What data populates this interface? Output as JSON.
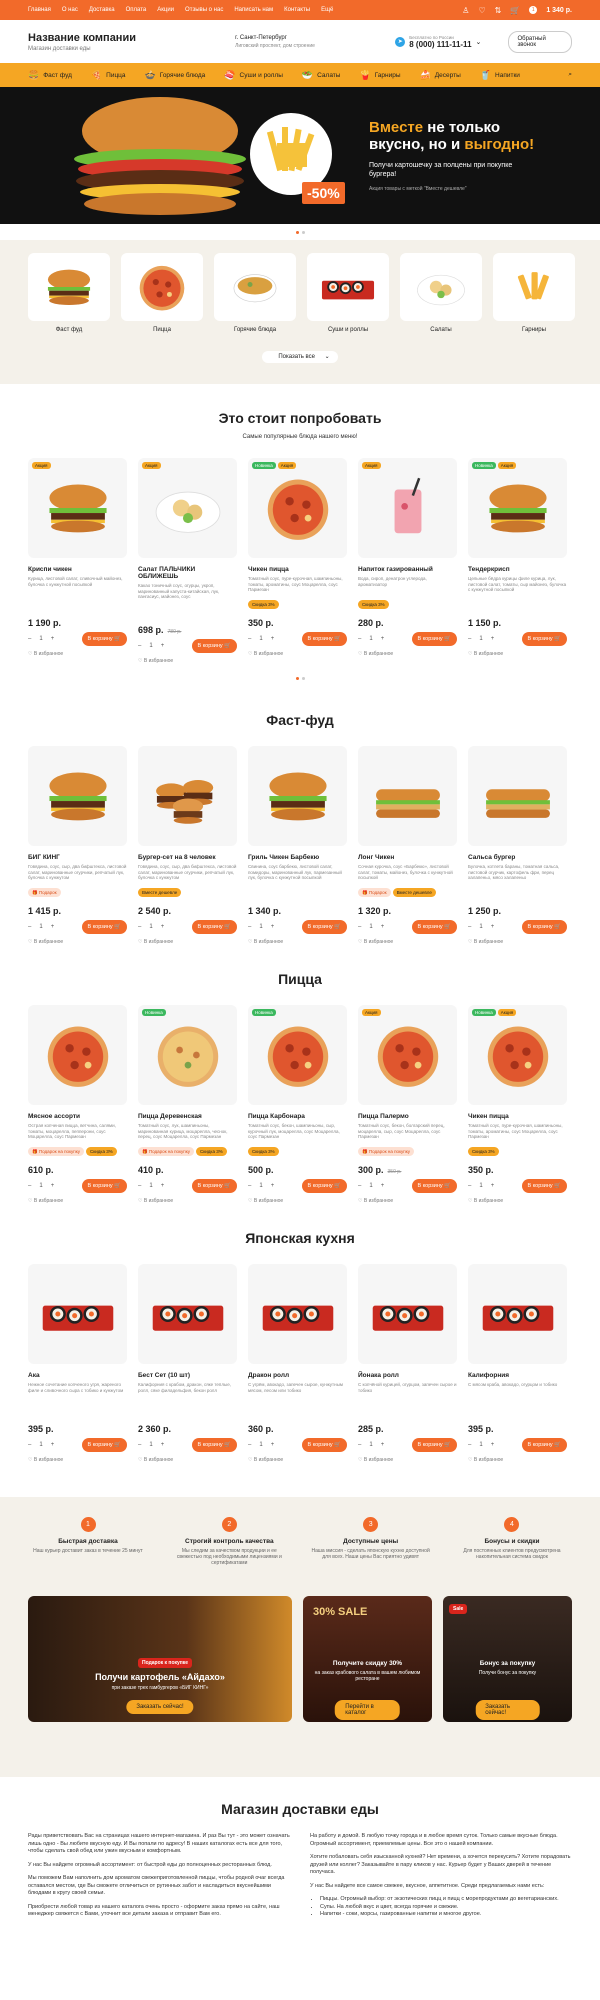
{
  "topnav": [
    "Главная",
    "О нас",
    "Доставка",
    "Оплата",
    "Акции",
    "Отзывы о нас",
    "Написать нам",
    "Контакты",
    "Ещё"
  ],
  "cart_count": "1",
  "cart_total": "1 340 р.",
  "brand": {
    "name": "Название компании",
    "sub": "Магазин доставки еды"
  },
  "address": {
    "city": "г. Санкт-Петербург",
    "street": "Лиговский проспект, дом строение"
  },
  "phone": {
    "caption": "Бесплатно по России",
    "number": "8 (000) 111-11-11"
  },
  "callback": "Обратный звонок",
  "categories_nav": [
    {
      "label": "Фаст фуд",
      "icon": "burger-icon"
    },
    {
      "label": "Пицца",
      "icon": "pizza-icon"
    },
    {
      "label": "Горячие блюда",
      "icon": "bowl-icon"
    },
    {
      "label": "Суши и роллы",
      "icon": "sushi-icon"
    },
    {
      "label": "Салаты",
      "icon": "salad-icon"
    },
    {
      "label": "Гарниры",
      "icon": "fries-icon"
    },
    {
      "label": "Десерты",
      "icon": "dessert-icon"
    },
    {
      "label": "Напитки",
      "icon": "drink-icon"
    }
  ],
  "hero": {
    "t1": "Вместе",
    "t2": " не только",
    "t3": "вкусно, но и ",
    "t4": "выгодно!",
    "percent": "-50%",
    "sub": "Получи картошечку за полцены при покупке бургера!",
    "note": "Акция товары с меткой \"Вместе дешевле\""
  },
  "catalog": [
    {
      "label": "Фаст фуд"
    },
    {
      "label": "Пицца"
    },
    {
      "label": "Горячие блюда"
    },
    {
      "label": "Суши и роллы"
    },
    {
      "label": "Салаты"
    },
    {
      "label": "Гарниры"
    }
  ],
  "show_all": "Показать все",
  "sections": [
    {
      "title": "Это стоит попробовать",
      "sub": "Самые популярные блюда нашего меню!",
      "items": [
        {
          "name": "Криспи чикен",
          "desc": "Курица, листовой салат, сливочный майонез, булочка с кунжутной посыпкой",
          "tags": [
            "Акция"
          ],
          "badges": [],
          "price": "1 190 р.",
          "old": "",
          "img": "burger"
        },
        {
          "name": "Салат ПАЛЬЧИКИ ОБЛИЖЕШЬ",
          "desc": "Какао тоничный соус, огурцы, укроп, маринованный капуста-китайская, лук, пангасиус, майонез, соус",
          "tags": [
            "Акция"
          ],
          "badges": [],
          "price": "698 р.",
          "old": "780 р.",
          "img": "salad"
        },
        {
          "name": "Чикен пицца",
          "desc": "Томатный соус, пуре-курочная, шампиньоны, томаты, ароматины, соус Моцарелла, соус Пармезан",
          "tags": [
            "Новинка",
            "Акция"
          ],
          "badges": [
            {
              "t": "Скидка 3%",
              "k": "s"
            }
          ],
          "price": "350 р.",
          "old": "",
          "img": "pizza"
        },
        {
          "name": "Напиток газированный",
          "desc": "Вода, сироп, денатрон углерода, ароматизатор",
          "tags": [
            "Акция"
          ],
          "badges": [
            {
              "t": "Скидка 3%",
              "k": "s"
            }
          ],
          "price": "280 р.",
          "old": "",
          "img": "drink"
        },
        {
          "name": "Тендеркрисп",
          "desc": "Цельные бёдра курицы филе курица, лук, листовой салат, томаты, сыр майонез, булочка с кунжутной посыпкой",
          "tags": [
            "Новинка",
            "Акция"
          ],
          "badges": [],
          "price": "1 150 р.",
          "old": "",
          "img": "burger"
        }
      ]
    },
    {
      "title": "Фаст-фуд",
      "sub": "",
      "items": [
        {
          "name": "БИГ КИНГ",
          "desc": "Говядина, соус, сыр, два бифштекса, листовой салат, маринованные огурчики, репчатый лук, булочка с кунжутом",
          "tags": [],
          "badges": [
            {
              "t": "Подарок",
              "k": "g"
            }
          ],
          "price": "1 415 р.",
          "old": "",
          "img": "burger"
        },
        {
          "name": "Бургер-сет на 8 человек",
          "desc": "Говядина, соус, сыр, два бифштекса, листовой салат, маринованные огурчики, репчатый лук, булочка с кунжутом",
          "tags": [],
          "badges": [
            {
              "t": "Вместе дешевле",
              "k": "s"
            }
          ],
          "price": "2 540 р.",
          "old": "",
          "img": "burgers"
        },
        {
          "name": "Гриль Чикен Барбекю",
          "desc": "Свинина, соус барбекю, листовой салат, помидоры, маринованный лук, пармезанный лук, булочка с кунжутной посыпкой",
          "tags": [],
          "badges": [],
          "price": "1 340 р.",
          "old": "",
          "img": "burger"
        },
        {
          "name": "Лонг Чикен",
          "desc": "Сочная курочка, соус «Барбекю», листовой салат, томаты, майонез, булочка с кунжутной посыпкой",
          "tags": [],
          "badges": [
            {
              "t": "Подарок",
              "k": "g"
            },
            {
              "t": "Вместе дешевле",
              "k": "s"
            }
          ],
          "price": "1 320 р.",
          "old": "",
          "img": "long"
        },
        {
          "name": "Сальса бургер",
          "desc": "Булочка, котлета бараны, томатная сальса, листовой огурчик, картофель фри, перец халапеньо, мясо халапеньо",
          "tags": [],
          "badges": [],
          "price": "1 250 р.",
          "old": "",
          "img": "long"
        }
      ]
    },
    {
      "title": "Пицца",
      "sub": "",
      "items": [
        {
          "name": "Мясное ассорти",
          "desc": "Острая копченая пицца, ветчина, салями, томаты, моцарелла, пепперони, соус Моцарелла, соус Пармезан",
          "tags": [],
          "badges": [
            {
              "t": "Подарок на покупку",
              "k": "g"
            },
            {
              "t": "Скидка 3%",
              "k": "s"
            }
          ],
          "price": "610 р.",
          "old": "",
          "img": "pizza"
        },
        {
          "name": "Пицца Деревенская",
          "desc": "Томатный соус, лук, шампиньоны, маринованная курица, моцарелла, чеснок, перец, соус Моцарелла, соус Пармезан",
          "tags": [
            "Новинка"
          ],
          "badges": [
            {
              "t": "Подарок на покупку",
              "k": "g"
            },
            {
              "t": "Скидка 3%",
              "k": "s"
            }
          ],
          "price": "410 р.",
          "old": "",
          "img": "pizza2"
        },
        {
          "name": "Пицца Карбонара",
          "desc": "Томатный соус, бекон, шампиньоны, сыр, курочный лук, моцарелла, соус Моцарелла, соус Пармезан",
          "tags": [
            "Новинка"
          ],
          "badges": [
            {
              "t": "Скидка 3%",
              "k": "s"
            }
          ],
          "price": "500 р.",
          "old": "",
          "img": "pizza"
        },
        {
          "name": "Пицца Палермо",
          "desc": "Томатный соус, бекон, болгарский перец, моцарелла, сыр, соус Моцарелла, соус Пармезан",
          "tags": [
            "Акция"
          ],
          "badges": [
            {
              "t": "Подарок на покупку",
              "k": "g"
            }
          ],
          "price": "300 р.",
          "old": "350 р.",
          "img": "pizza"
        },
        {
          "name": "Чикен пицца",
          "desc": "Томатный соус, пуре-курочная, шампиньоны, томаты, ароматины, соус Моцарелла, соус Пармезан",
          "tags": [
            "Новинка",
            "Акция"
          ],
          "badges": [
            {
              "t": "Скидка 3%",
              "k": "s"
            }
          ],
          "price": "350 р.",
          "old": "",
          "img": "pizza"
        }
      ]
    },
    {
      "title": "Японская кухня",
      "sub": "",
      "items": [
        {
          "name": "Ака",
          "desc": "Нежное сочетание копченого угря, жареного филе и сливочного сыра с тобико и кунжутом",
          "tags": [],
          "badges": [],
          "price": "395 р.",
          "old": "",
          "img": "sushi"
        },
        {
          "name": "Бест Сет (10 шт)",
          "desc": "Калифорния с крабом, дракон, сяке теплые, ролл, сяке филадельфия, бекон ролл",
          "tags": [],
          "badges": [],
          "price": "2 360 р.",
          "old": "",
          "img": "sushi"
        },
        {
          "name": "Дракон ролл",
          "desc": "С угрём, авокадо, запечен сырое, кунжутным мясом, лесом или тобико",
          "tags": [],
          "badges": [],
          "price": "360 р.",
          "old": "",
          "img": "sushi"
        },
        {
          "name": "Йонака ролл",
          "desc": "С копчёной курицей, огурцом, запечен сырое и тобико",
          "tags": [],
          "badges": [],
          "price": "285 р.",
          "old": "",
          "img": "sushi"
        },
        {
          "name": "Калифорния",
          "desc": "С мясом краба, авокадо, огурцом и тобико",
          "tags": [],
          "badges": [],
          "price": "395 р.",
          "old": "",
          "img": "sushi"
        }
      ]
    }
  ],
  "to_cart": "В корзину",
  "favorite": "В избранное",
  "qty": "1",
  "advantages": [
    {
      "n": "1",
      "t": "Быстрая доставка",
      "d": "Наш курьер доставит заказ в течение 25 минут"
    },
    {
      "n": "2",
      "t": "Строгий контроль качества",
      "d": "Мы следим за качеством продукции и ее свежестью под необходимыми лицензиями и сертификатами"
    },
    {
      "n": "3",
      "t": "Доступные цены",
      "d": "Наша миссия - сделать японскую кухню доступной для всех. Наши цены Вас приятно удивят"
    },
    {
      "n": "4",
      "t": "Бонусы и скидки",
      "d": "Для постоянных клиентов предусмотрена накопительная система скидок"
    }
  ],
  "promos": [
    {
      "badge": "Подарок к покупке",
      "title": "Получи картофель «Айдахо»",
      "sub": "при заказе трех гамбургеров «БИГ КИНГ»",
      "btn": "Заказать сейчас!"
    },
    {
      "badge": "30% SALE",
      "title": "Получите скидку 30%",
      "sub": "на заказ крабового салата в вашем любимом ресторане",
      "btn": "Перейти в каталог"
    },
    {
      "badge": "Sale",
      "title": "Бонус за покупку",
      "sub": "Получи бонус за покупку",
      "btn": "Заказать сейчас!"
    }
  ],
  "seo": {
    "title": "Магазин доставки еды",
    "left": [
      "Рады приветствовать Вас на страницах нашего интернет-магазина. И раз Вы тут - это может означать лишь одно - Вы любите вкусную еду. И Вы попали по адресу! В наших каталогах есть все для того, чтобы сделать свой обед или ужин вкусным и комфортным.",
      "У нас Вы найдете огромный ассортимент: от быстрой еды до полноценных ресторанных блюд.",
      "Мы поможем Вам наполнить дом ароматом свежеприготовленной пиццы, чтобы родной очаг всегда оставался местом, где Вы сможете отличиться от рутинных забот и насладиться вкуснейшими блюдами в кругу своей семьи.",
      "Приобрести любой товар из нашего каталога очень просто - оформите заказ прямо на сайте, наш менеджер свяжется с Вами, уточнит все детали заказа и отправит Вам его."
    ],
    "right": [
      "На работу и домой. В любую точку города и в любое время суток. Только самые вкусные блюда. Огромный ассортимент, приемлемые цены. Все это о нашей компании.",
      "Хотите побаловать себя изысканной кухней? Нет времени, а хочется перекусить? Хотите порадовать друзей или коллег? Заказывайте в пару кликов у нас. Курьер будет у Ваших дверей в течение получаса.",
      "У нас Вы найдете все самое свежее, вкусное, аппетитное. Среди предлагаемых нами есть:"
    ],
    "list": [
      "Пиццы. Огромный выбор: от экзотических пицц и пицц с морепродуктами до вегетарианских.",
      "Супы. На любой вкус и цвет, всегда горячие и свежие.",
      "Напитки - соки, морсы, газированные напитки и многое другое."
    ]
  }
}
